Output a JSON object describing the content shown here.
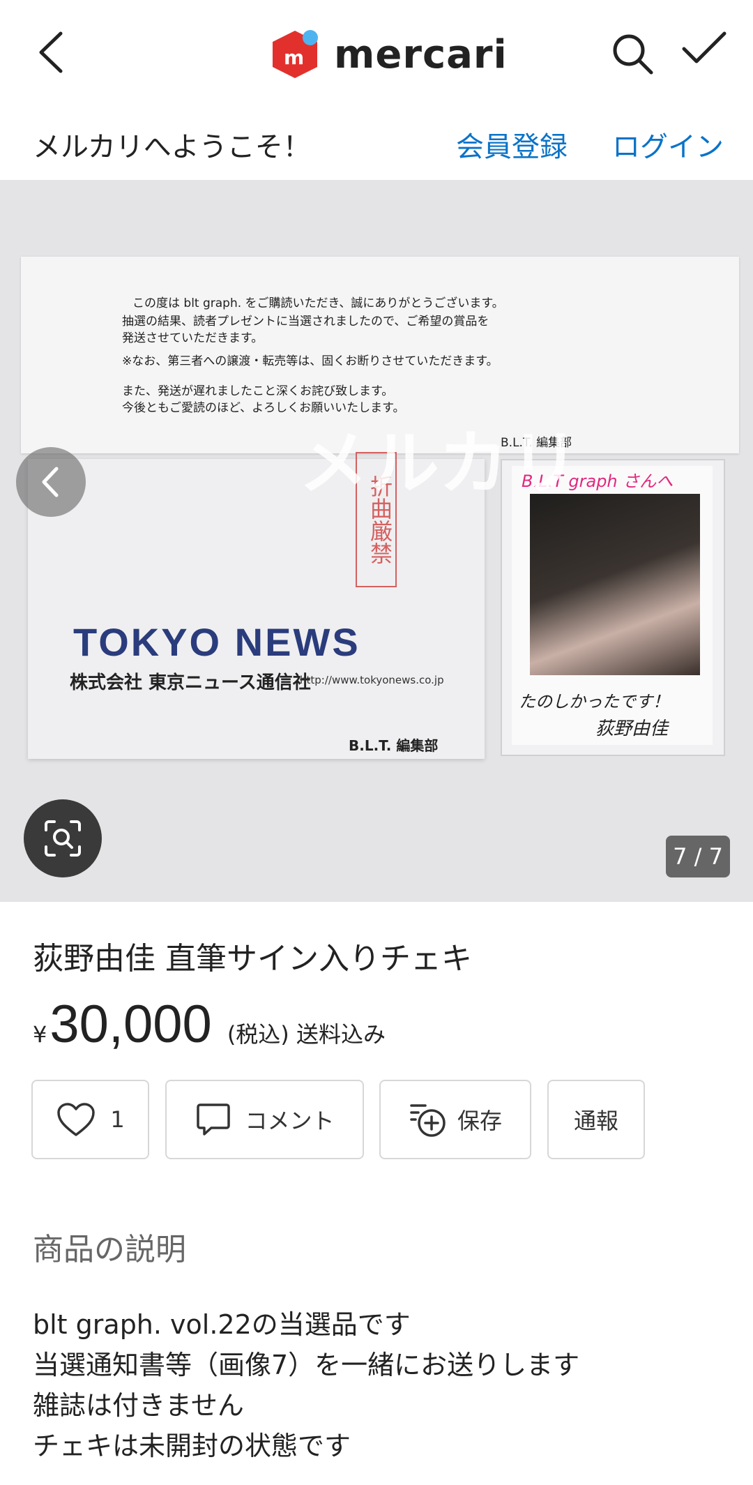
{
  "header": {
    "logo_text": "mercari",
    "icons": [
      "back-icon",
      "search-icon",
      "check-icon",
      "mercari-logo-icon"
    ],
    "colors": {
      "logo_red": "#e2312c",
      "logo_dot": "#4fb3f0"
    }
  },
  "welcome": {
    "message": "メルカリへようこそ！",
    "register": "会員登録",
    "login": "ログイン",
    "link_color": "#0a73c8"
  },
  "photo": {
    "letter_lines": [
      "この度は blt graph. をご購読いただき、誠にありがとうございます。",
      "抽選の結果、読者プレゼントに当選されましたので、ご希望の賞品を",
      "発送させていただきます。",
      "※なお、第三者への譲渡・転売等は、固くお断りさせていただきます。",
      "また、発送が遅れましたこと深くお詫び致します。",
      "今後ともご愛読のほど、よろしくお願いいたします。",
      "B.L.T. 編集部"
    ],
    "stamp_text": "折曲厳禁",
    "envelope_brand": "TOKYO NEWS",
    "envelope_company": "株式会社 東京ニュース通信社",
    "envelope_url": "http://www.tokyonews.co.jp",
    "envelope_editor": "B.L.T. 編集部",
    "polaroid_top": "B.L.T graph さんへ",
    "polaroid_message": "たのしかったです！",
    "polaroid_signature": "荻野由佳",
    "watermark": "メルカリ",
    "counter": "7 / 7"
  },
  "item": {
    "title": "荻野由佳 直筆サイン入りチェキ",
    "currency": "¥",
    "price": "30,000",
    "tax_shipping": "(税込) 送料込み"
  },
  "actions": {
    "like_count": "1",
    "comment": "コメント",
    "save": "保存",
    "report": "通報"
  },
  "description": {
    "heading": "商品の説明",
    "lines": [
      "blt graph. vol.22の当選品です",
      "当選通知書等（画像7）を一緒にお送りします",
      "雑誌は付きません",
      "チェキは未開封の状態です"
    ]
  }
}
